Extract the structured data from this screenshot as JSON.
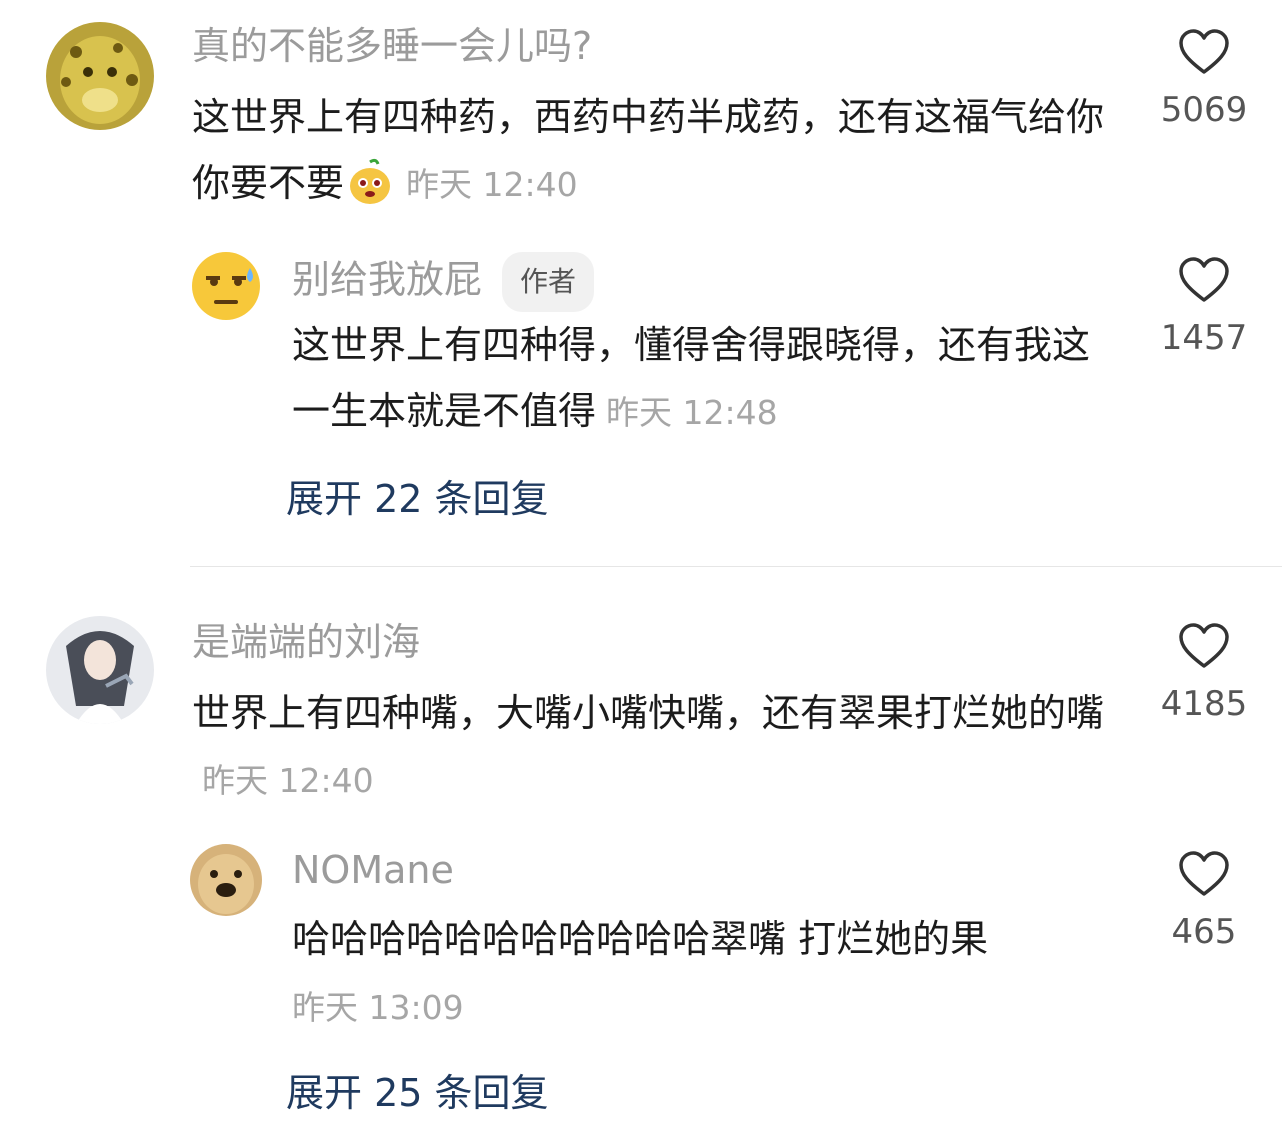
{
  "comments": [
    {
      "user": "真的不能多睡一会儿吗?",
      "text": "这世界上有四种药，西药中药半成药，还有这福气给你你要不要",
      "emoji": "mango-smile-emoji",
      "time": "昨天 12:40",
      "likes": "5069",
      "reply": {
        "user": "别给我放屁",
        "badge": "作者",
        "text": "这世界上有四种得，懂得舍得跟晓得，还有我这一生本就是不值得",
        "time": "昨天 12:48",
        "likes": "1457"
      },
      "expand": "展开 22 条回复"
    },
    {
      "user": "是端端的刘海",
      "text": "世界上有四种嘴，大嘴小嘴快嘴，还有翠果打烂她的嘴",
      "time": "昨天 12:40",
      "likes": "4185",
      "reply": {
        "user": "NOMane",
        "text": "哈哈哈哈哈哈哈哈哈哈哈翠嘴 打烂她的果",
        "time": "昨天 13:09",
        "likes": "465"
      },
      "expand": "展开 25 条回复"
    }
  ],
  "colors": {
    "expand": "#1f3a5f",
    "name": "#9b9b9b",
    "text": "#1c1c1c"
  }
}
